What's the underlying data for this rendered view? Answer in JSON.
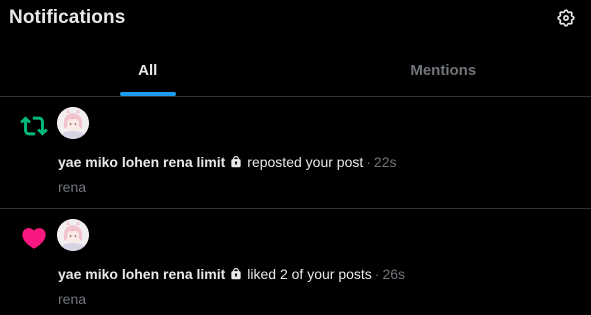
{
  "header": {
    "title": "Notifications",
    "settings_icon": "gear-icon"
  },
  "tabs": [
    {
      "label": "All",
      "active": true
    },
    {
      "label": "Mentions",
      "active": false
    }
  ],
  "colors": {
    "accent": "#1d9bf0",
    "retweet": "#00ba7c",
    "like": "#f91880",
    "muted": "#71767b",
    "text": "#e7e9ea",
    "divider": "#2f3336"
  },
  "notifications": [
    {
      "type": "repost",
      "type_icon": "repost-icon",
      "user": "yae miko lohen rena limit",
      "locked": true,
      "action": "reposted your post",
      "separator": "·",
      "time": "22s",
      "preview": "rena"
    },
    {
      "type": "like",
      "type_icon": "heart-icon",
      "user": "yae miko lohen rena limit",
      "locked": true,
      "action": "liked 2 of your posts",
      "separator": "·",
      "time": "26s",
      "preview": "rena"
    }
  ]
}
